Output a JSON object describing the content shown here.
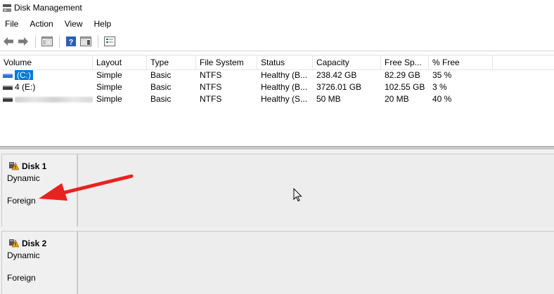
{
  "window": {
    "title": "Disk Management"
  },
  "menu": [
    "File",
    "Action",
    "View",
    "Help"
  ],
  "toolbar": {
    "buttons": [
      "back-arrow-icon",
      "forward-arrow-icon",
      "console-tree-icon",
      "help-icon",
      "action-pane-icon",
      "properties-icon"
    ]
  },
  "volume_table": {
    "columns": [
      "Volume",
      "Layout",
      "Type",
      "File System",
      "Status",
      "Capacity",
      "Free Sp...",
      "% Free"
    ],
    "rows": [
      {
        "volume": "(C:)",
        "layout": "Simple",
        "type": "Basic",
        "fs": "NTFS",
        "status": "Healthy (B...",
        "capacity": "238.42 GB",
        "free": "82.29 GB",
        "pct": "35 %"
      },
      {
        "volume": "4 (E:)",
        "layout": "Simple",
        "type": "Basic",
        "fs": "NTFS",
        "status": "Healthy (B...",
        "capacity": "3726.01 GB",
        "free": "102.55 GB",
        "pct": "3 %"
      },
      {
        "volume": "",
        "layout": "Simple",
        "type": "Basic",
        "fs": "NTFS",
        "status": "Healthy (S...",
        "capacity": "50 MB",
        "free": "20 MB",
        "pct": "40 %"
      }
    ]
  },
  "disks": [
    {
      "name": "Disk 1",
      "type": "Dynamic",
      "status": "Foreign"
    },
    {
      "name": "Disk 2",
      "type": "Dynamic",
      "status": "Foreign"
    }
  ],
  "colors": {
    "selection": "#0078d7",
    "annotation_arrow": "#e8231f",
    "warning": "#e8a317"
  }
}
